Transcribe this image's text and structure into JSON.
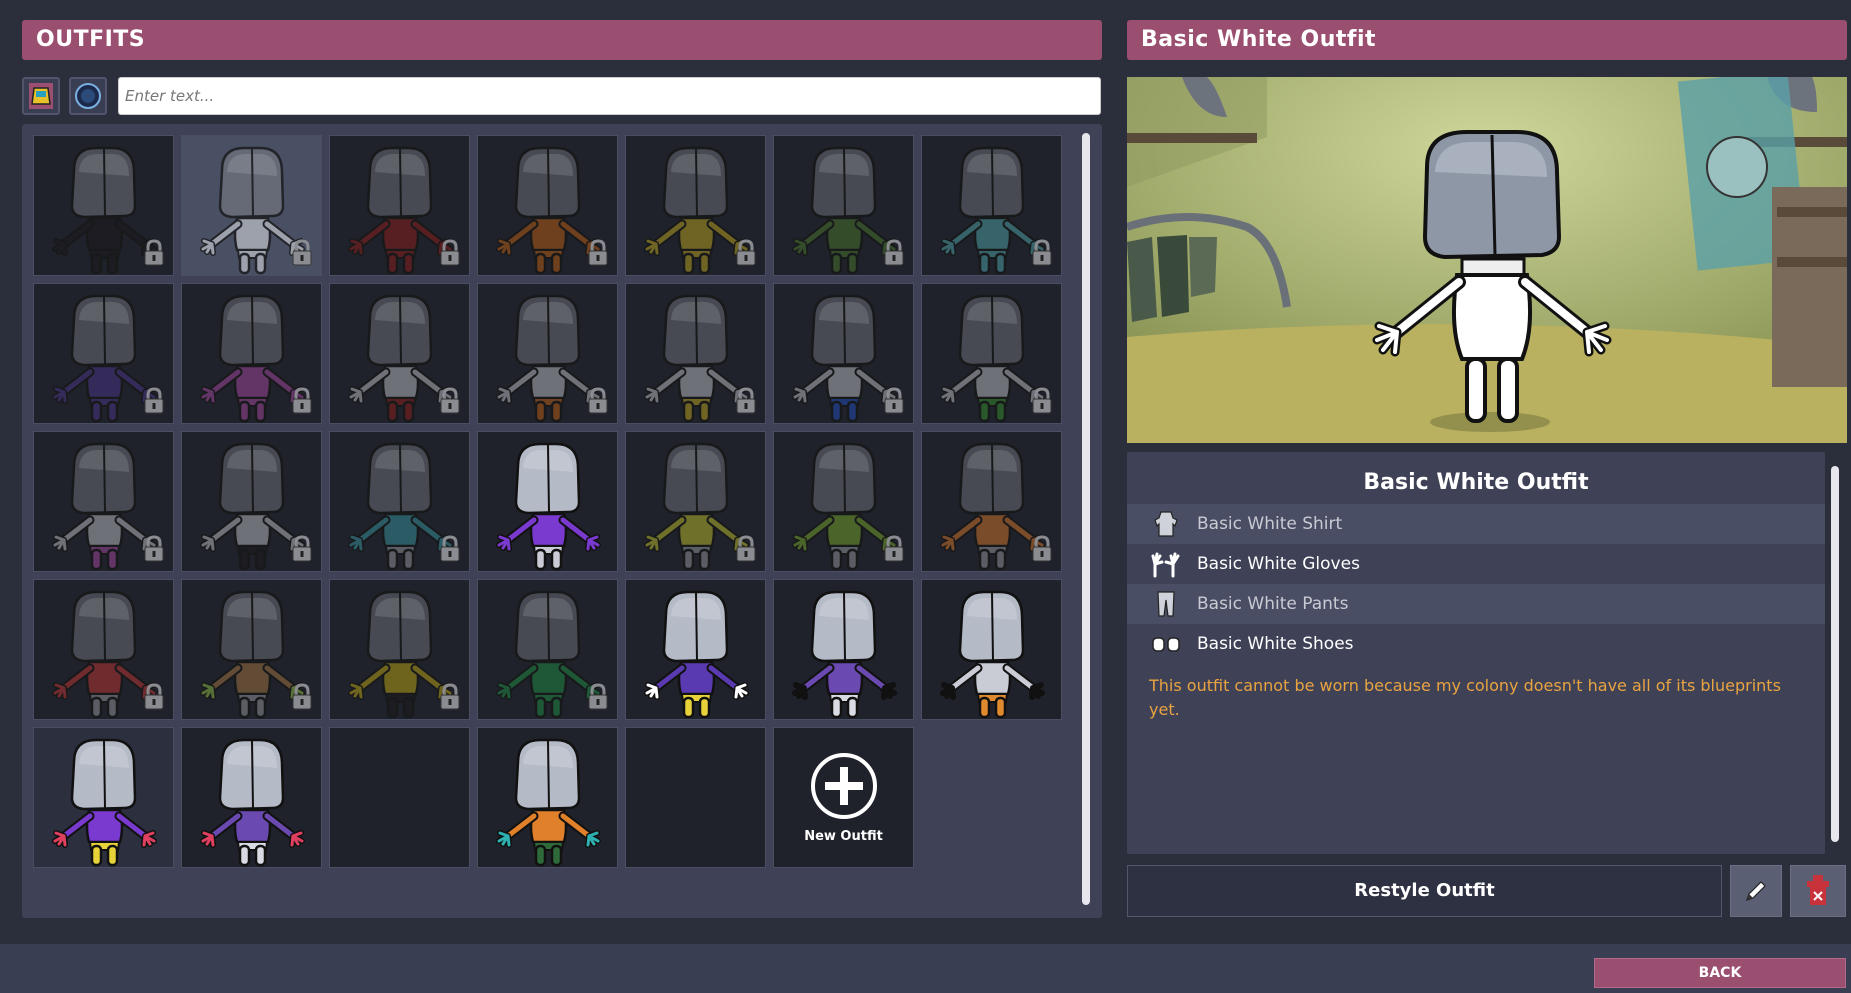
{
  "left_panel": {
    "title": "OUTFITS",
    "search_placeholder": "Enter text...",
    "new_outfit_label": "New Outfit",
    "tiles": [
      {
        "shirt": "#1b1b1f",
        "pants": "#1b1b1f",
        "gloves": "#1b1b1f",
        "head": "#5a5d66",
        "locked": true,
        "bright": false
      },
      {
        "shirt": "#b9bcc4",
        "pants": "#b9bcc4",
        "gloves": "#b9bcc4",
        "head": "#6f737d",
        "locked": true,
        "bright": false,
        "selected": true
      },
      {
        "shirt": "#6a1e1e",
        "pants": "#6a1e1e",
        "gloves": "#6a1e1e",
        "head": "#55585f",
        "locked": true,
        "bright": false
      },
      {
        "shirt": "#8a4a1a",
        "pants": "#8a4a1a",
        "gloves": "#8a4a1a",
        "head": "#55585f",
        "locked": true,
        "bright": false
      },
      {
        "shirt": "#8a7a22",
        "pants": "#8a7a22",
        "gloves": "#8a7a22",
        "head": "#55585f",
        "locked": true,
        "bright": false
      },
      {
        "shirt": "#3b5a2a",
        "pants": "#3b5a2a",
        "gloves": "#3b5a2a",
        "head": "#55585f",
        "locked": true,
        "bright": false
      },
      {
        "shirt": "#3e7a80",
        "pants": "#3e7a80",
        "gloves": "#3e7a80",
        "head": "#55585f",
        "locked": true,
        "bright": false
      },
      {
        "shirt": "#3d2f6a",
        "pants": "#3d2f6a",
        "gloves": "#3d2f6a",
        "head": "#55585f",
        "locked": true,
        "bright": false
      },
      {
        "shirt": "#7a3a7a",
        "pants": "#7a3a7a",
        "gloves": "#7a3a7a",
        "head": "#55585f",
        "locked": true,
        "bright": false
      },
      {
        "shirt": "#8a8c92",
        "pants": "#6a1e1e",
        "gloves": "#8a8c92",
        "head": "#55585f",
        "locked": true,
        "bright": false
      },
      {
        "shirt": "#8a8c92",
        "pants": "#8a4a1a",
        "gloves": "#8a8c92",
        "head": "#55585f",
        "locked": true,
        "bright": false
      },
      {
        "shirt": "#8a8c92",
        "pants": "#8a7a22",
        "gloves": "#8a8c92",
        "head": "#55585f",
        "locked": true,
        "bright": false
      },
      {
        "shirt": "#8a8c92",
        "pants": "#1f3f8a",
        "gloves": "#8a8c92",
        "head": "#55585f",
        "locked": true,
        "bright": false
      },
      {
        "shirt": "#8a8c92",
        "pants": "#2f6a2a",
        "gloves": "#8a8c92",
        "head": "#55585f",
        "locked": true,
        "bright": false
      },
      {
        "shirt": "#8a8c92",
        "pants": "#7a3a7a",
        "gloves": "#8a8c92",
        "head": "#55585f",
        "locked": true,
        "bright": false
      },
      {
        "shirt": "#8a8c92",
        "pants": "#1b1b1f",
        "gloves": "#8a8c92",
        "head": "#55585f",
        "locked": true,
        "bright": false
      },
      {
        "shirt": "#2f6f78",
        "pants": "#6f7178",
        "gloves": "#2f6f78",
        "head": "#55585f",
        "locked": true,
        "bright": false
      },
      {
        "shirt": "#7a3ad0",
        "pants": "#c9ccd4",
        "gloves": "#7a3ad0",
        "head": "#b4bac6",
        "locked": false,
        "bright": true
      },
      {
        "shirt": "#8a8a2a",
        "pants": "#6f7178",
        "gloves": "#8a8a2a",
        "head": "#55585f",
        "locked": true,
        "bright": false
      },
      {
        "shirt": "#5a7a2a",
        "pants": "#6f7178",
        "gloves": "#5a7a2a",
        "head": "#55585f",
        "locked": true,
        "bright": false
      },
      {
        "shirt": "#9a5a2a",
        "pants": "#6f7178",
        "gloves": "#9a5a2a",
        "head": "#55585f",
        "locked": true,
        "bright": false
      },
      {
        "shirt": "#8a2f2f",
        "pants": "#6f7178",
        "gloves": "#8a2f2f",
        "head": "#55585f",
        "locked": true,
        "bright": false
      },
      {
        "shirt": "#7a5a3a",
        "pants": "#6f7178",
        "gloves": "#6a8a3a",
        "head": "#55585f",
        "locked": true,
        "bright": false
      },
      {
        "shirt": "#8a7a1a",
        "pants": "#1b1b1f",
        "gloves": "#8a7a1a",
        "head": "#55585f",
        "locked": true,
        "bright": false
      },
      {
        "shirt": "#1f6a3a",
        "pants": "#1f6a3a",
        "gloves": "#1f6a3a",
        "head": "#55585f",
        "locked": true,
        "bright": false
      },
      {
        "shirt": "#5a3ab0",
        "pants": "#e8d23a",
        "gloves": "#ffffff",
        "head": "#b4bac6",
        "locked": false,
        "bright": true
      },
      {
        "shirt": "#6a4ab0",
        "pants": "#d8dbe2",
        "gloves": "#111111",
        "head": "#b4bac6",
        "locked": false,
        "bright": true
      },
      {
        "shirt": "#c9ccd4",
        "pants": "#e08a30",
        "gloves": "#111111",
        "head": "#b4bac6",
        "locked": false,
        "bright": true
      },
      {
        "shirt": "#7a3ad0",
        "pants": "#e8d23a",
        "gloves": "#e04060",
        "head": "#b4bac6",
        "locked": false,
        "bright": true,
        "hl": true
      },
      {
        "shirt": "#6a4ab0",
        "pants": "#d8dbe2",
        "gloves": "#e04060",
        "head": "#b4bac6",
        "locked": false,
        "bright": true
      },
      {
        "empty": true
      },
      {
        "shirt": "#e0802a",
        "pants": "#2f6a3a",
        "gloves": "#2fb0b0",
        "head": "#b4bac6",
        "locked": false,
        "bright": true
      },
      {
        "empty": true
      },
      {
        "new": true
      }
    ]
  },
  "right_panel": {
    "title": "Basic White Outfit",
    "detail_title": "Basic White Outfit",
    "items": [
      {
        "label": "Basic White Shirt",
        "icon": "shirt-icon"
      },
      {
        "label": "Basic White Gloves",
        "icon": "gloves-icon"
      },
      {
        "label": "Basic White Pants",
        "icon": "pants-icon"
      },
      {
        "label": "Basic White Shoes",
        "icon": "shoes-icon"
      }
    ],
    "warning": "This outfit cannot be worn because my colony doesn't have all of its blueprints yet.",
    "restyle_label": "Restyle Outfit"
  },
  "footer": {
    "back_label": "BACK"
  },
  "colors": {
    "accent": "#9b4f70",
    "panel": "#3f4256",
    "background": "#2b2e3b",
    "warning": "#e9a340"
  }
}
